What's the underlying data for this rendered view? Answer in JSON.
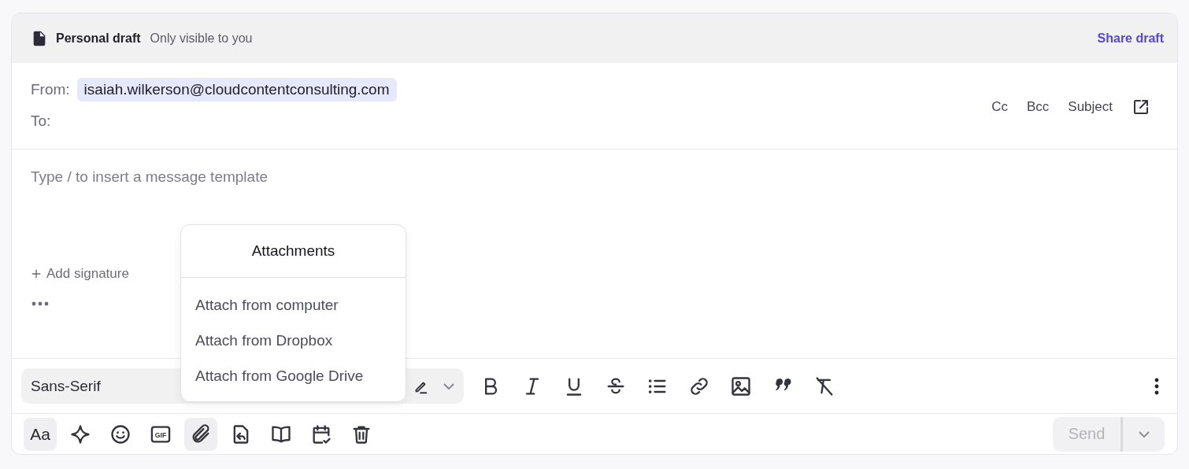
{
  "header": {
    "title": "Personal draft",
    "subtitle": "Only visible to you",
    "share_link": "Share draft"
  },
  "from": {
    "label": "From:",
    "address": "isaiah.wilkerson@cloudcontentconsulting.com"
  },
  "to": {
    "label": "To:"
  },
  "field_toggles": [
    "Cc",
    "Bcc",
    "Subject"
  ],
  "body": {
    "placeholder": "Type / to insert a message template",
    "add_signature": "Add signature"
  },
  "format_bar": {
    "font": "Sans-Serif",
    "tools": [
      {
        "kind": "bold"
      },
      {
        "kind": "italic"
      },
      {
        "kind": "underline"
      },
      {
        "kind": "strike"
      },
      {
        "kind": "list"
      },
      {
        "kind": "link"
      },
      {
        "kind": "image"
      },
      {
        "kind": "quote"
      },
      {
        "kind": "clear"
      }
    ]
  },
  "bottom_tools": [
    {
      "kind": "text",
      "label": "Aa",
      "selected": true
    },
    {
      "kind": "sparkle",
      "selected": false
    },
    {
      "kind": "emoji",
      "selected": false
    },
    {
      "kind": "gif",
      "label": "GIF",
      "selected": false
    },
    {
      "kind": "clip",
      "selected": true
    },
    {
      "kind": "reply",
      "selected": false
    },
    {
      "kind": "book",
      "selected": false
    },
    {
      "kind": "calendar",
      "selected": false
    },
    {
      "kind": "trash",
      "selected": false
    }
  ],
  "send": {
    "label": "Send",
    "disabled": true
  },
  "attachments_menu": {
    "title": "Attachments",
    "items": [
      "Attach from computer",
      "Attach from Dropbox",
      "Attach from Google Drive"
    ]
  }
}
